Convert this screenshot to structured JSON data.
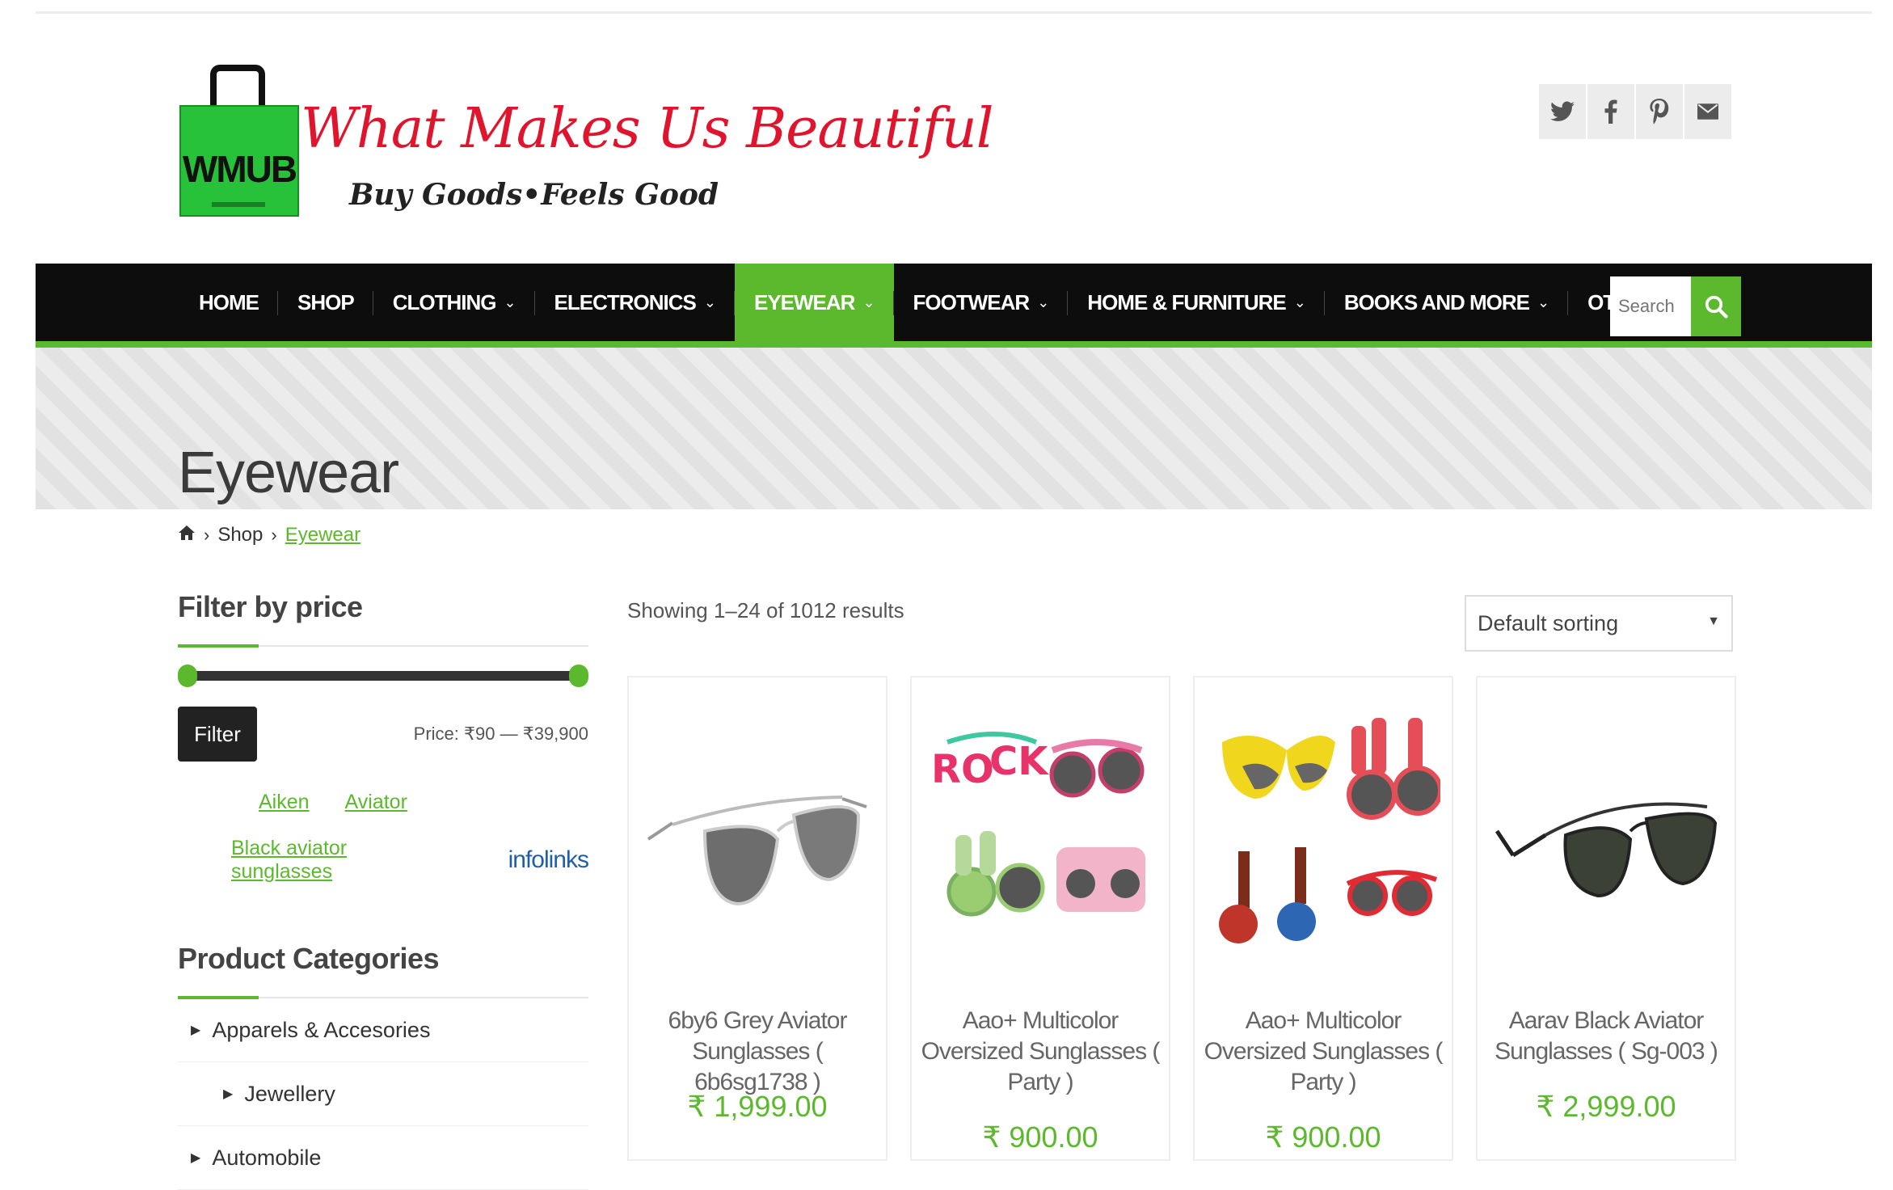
{
  "header": {
    "logo_mark": "WMUB",
    "logo_script": "What Makes Us Beautiful",
    "tagline": "Buy Goods•Feels Good",
    "social": [
      {
        "icon": "twitter-icon",
        "glyph": "𝕂"
      },
      {
        "icon": "facebook-icon",
        "glyph": "f"
      },
      {
        "icon": "pinterest-icon",
        "glyph": "p"
      },
      {
        "icon": "email-icon",
        "glyph": "✉"
      }
    ]
  },
  "nav": {
    "items": [
      {
        "label": "HOME",
        "dropdown": false
      },
      {
        "label": "SHOP",
        "dropdown": false
      },
      {
        "label": "CLOTHING",
        "dropdown": true
      },
      {
        "label": "ELECTRONICS",
        "dropdown": true
      },
      {
        "label": "EYEWEAR",
        "dropdown": true,
        "active": true
      },
      {
        "label": "FOOTWEAR",
        "dropdown": true
      },
      {
        "label": "HOME & FURNITURE",
        "dropdown": true
      },
      {
        "label": "BOOKS AND MORE",
        "dropdown": true
      },
      {
        "label": "OTHERS",
        "dropdown": true
      }
    ],
    "search_placeholder": "Search"
  },
  "page": {
    "title": "Eyewear",
    "breadcrumb": [
      "Shop",
      "Eyewear"
    ]
  },
  "sidebar": {
    "filter_title": "Filter by price",
    "filter_button": "Filter",
    "price_range": "Price: ₹90 — ₹39,900",
    "tags_row1": [
      "Aiken",
      "Aviator"
    ],
    "tag_row2": "Black aviator sunglasses",
    "ad_label": "infolinks",
    "categories_title": "Product Categories",
    "categories": [
      {
        "label": "Apparels & Accesories",
        "sub": false
      },
      {
        "label": "Jewellery",
        "sub": true
      },
      {
        "label": "Automobile",
        "sub": false
      }
    ]
  },
  "shop": {
    "result_count": "Showing 1–24 of 1012 results",
    "sort_selected": "Default sorting"
  },
  "products": [
    {
      "name": "6by6 Grey Aviator Sunglasses ( 6b6sg1738 )",
      "price": "₹ 1,999.00"
    },
    {
      "name": "Aao+ Multicolor Oversized Sunglasses ( Party )",
      "price": "₹ 900.00"
    },
    {
      "name": "Aao+ Multicolor Oversized Sunglasses ( Party )",
      "price": "₹ 900.00"
    },
    {
      "name": "Aarav Black Aviator Sunglasses ( Sg-003 )",
      "price": "₹ 2,999.00"
    }
  ],
  "colors": {
    "accent": "#5cb82d",
    "navbar": "#0d0d0d",
    "logo_red": "#e0142c",
    "logo_green": "#27c23a"
  }
}
